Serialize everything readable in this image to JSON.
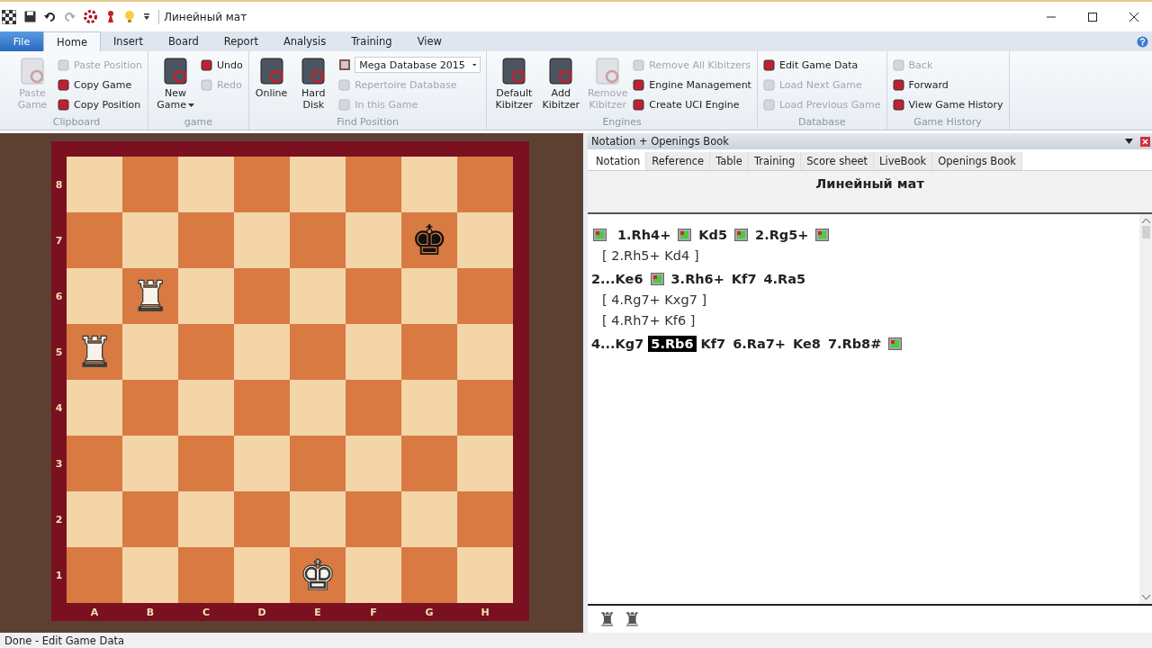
{
  "window": {
    "title": "Линейный мат"
  },
  "ribbon_tabs": [
    {
      "label": "File",
      "kind": "file",
      "selected": false
    },
    {
      "label": "Home",
      "kind": "tab",
      "selected": true
    },
    {
      "label": "Insert",
      "kind": "tab",
      "selected": false
    },
    {
      "label": "Board",
      "kind": "tab",
      "selected": false
    },
    {
      "label": "Report",
      "kind": "tab",
      "selected": false
    },
    {
      "label": "Analysis",
      "kind": "tab",
      "selected": false
    },
    {
      "label": "Training",
      "kind": "tab",
      "selected": false
    },
    {
      "label": "View",
      "kind": "tab",
      "selected": false
    }
  ],
  "ribbon_groups": [
    {
      "label": "Clipboard",
      "items": [
        {
          "kind": "large",
          "label": "Paste Game",
          "disabled": true,
          "menu": false
        },
        {
          "kind": "column",
          "entries": [
            {
              "kind": "small",
              "label": "Paste Position",
              "disabled": true
            },
            {
              "kind": "small",
              "label": "Copy Game",
              "disabled": false
            },
            {
              "kind": "small",
              "label": "Copy Position",
              "disabled": false
            }
          ]
        }
      ]
    },
    {
      "label": "game",
      "items": [
        {
          "kind": "large",
          "label": "New Game",
          "disabled": false,
          "menu": true
        },
        {
          "kind": "column",
          "entries": [
            {
              "kind": "small",
              "label": "Undo",
              "disabled": false
            },
            {
              "kind": "small",
              "label": "Redo",
              "disabled": true
            }
          ]
        }
      ]
    },
    {
      "label": "Find Position",
      "items": [
        {
          "kind": "large",
          "label": "Online",
          "disabled": false,
          "menu": false
        },
        {
          "kind": "large",
          "label": "Hard Disk",
          "disabled": false,
          "menu": false
        },
        {
          "kind": "column",
          "entries": [
            {
              "kind": "combo",
              "label": "Mega Database 2015",
              "disabled": false
            },
            {
              "kind": "small",
              "label": "Repertoire Database",
              "disabled": true
            },
            {
              "kind": "small",
              "label": "In this Game",
              "disabled": true
            }
          ]
        }
      ]
    },
    {
      "label": "Engines",
      "items": [
        {
          "kind": "large",
          "label": "Default Kibitzer",
          "disabled": false,
          "menu": false
        },
        {
          "kind": "large",
          "label": "Add Kibitzer",
          "disabled": false,
          "menu": false
        },
        {
          "kind": "large",
          "label": "Remove Kibitzer",
          "disabled": true,
          "menu": false
        },
        {
          "kind": "column",
          "entries": [
            {
              "kind": "small",
              "label": "Remove All Kibitzers",
              "disabled": true
            },
            {
              "kind": "small",
              "label": "Engine Management",
              "disabled": false
            },
            {
              "kind": "small",
              "label": "Create UCI Engine",
              "disabled": false
            }
          ]
        }
      ]
    },
    {
      "label": "Database",
      "items": [
        {
          "kind": "column",
          "entries": [
            {
              "kind": "small",
              "label": "Edit Game Data",
              "disabled": false
            },
            {
              "kind": "small",
              "label": "Load Next Game",
              "disabled": true
            },
            {
              "kind": "small",
              "label": "Load Previous Game",
              "disabled": true
            }
          ]
        }
      ]
    },
    {
      "label": "Game History",
      "items": [
        {
          "kind": "column",
          "entries": [
            {
              "kind": "small",
              "label": "Back",
              "disabled": true
            },
            {
              "kind": "small",
              "label": "Forward",
              "disabled": false
            },
            {
              "kind": "small",
              "label": "View Game History",
              "disabled": false
            }
          ]
        }
      ]
    }
  ],
  "board": {
    "files": [
      "A",
      "B",
      "C",
      "D",
      "E",
      "F",
      "G",
      "H"
    ],
    "rows": [
      {
        "rank": "8",
        "cells": [
          {
            "light": true
          },
          {
            "light": false
          },
          {
            "light": true
          },
          {
            "light": false
          },
          {
            "light": true
          },
          {
            "light": false
          },
          {
            "light": true
          },
          {
            "light": false
          }
        ]
      },
      {
        "rank": "7",
        "cells": [
          {
            "light": false
          },
          {
            "light": true
          },
          {
            "light": false
          },
          {
            "light": true
          },
          {
            "light": false
          },
          {
            "light": true
          },
          {
            "light": false,
            "piece": "♚",
            "black": true
          },
          {
            "light": true
          }
        ]
      },
      {
        "rank": "6",
        "cells": [
          {
            "light": true
          },
          {
            "light": false,
            "piece": "♜",
            "black": false
          },
          {
            "light": true
          },
          {
            "light": false
          },
          {
            "light": true
          },
          {
            "light": false
          },
          {
            "light": true
          },
          {
            "light": false
          }
        ]
      },
      {
        "rank": "5",
        "cells": [
          {
            "light": false,
            "piece": "♜",
            "black": false
          },
          {
            "light": true
          },
          {
            "light": false
          },
          {
            "light": true
          },
          {
            "light": false
          },
          {
            "light": true
          },
          {
            "light": false
          },
          {
            "light": true
          }
        ]
      },
      {
        "rank": "4",
        "cells": [
          {
            "light": true
          },
          {
            "light": false
          },
          {
            "light": true
          },
          {
            "light": false
          },
          {
            "light": true
          },
          {
            "light": false
          },
          {
            "light": true
          },
          {
            "light": false
          }
        ]
      },
      {
        "rank": "3",
        "cells": [
          {
            "light": false
          },
          {
            "light": true
          },
          {
            "light": false
          },
          {
            "light": true
          },
          {
            "light": false
          },
          {
            "light": true
          },
          {
            "light": false
          },
          {
            "light": true
          }
        ]
      },
      {
        "rank": "2",
        "cells": [
          {
            "light": true
          },
          {
            "light": false
          },
          {
            "light": true
          },
          {
            "light": false
          },
          {
            "light": true
          },
          {
            "light": false
          },
          {
            "light": true
          },
          {
            "light": false
          }
        ]
      },
      {
        "rank": "1",
        "cells": [
          {
            "light": false
          },
          {
            "light": true
          },
          {
            "light": false
          },
          {
            "light": true
          },
          {
            "light": false,
            "piece": "♚",
            "black": false
          },
          {
            "light": true
          },
          {
            "light": false
          },
          {
            "light": true
          }
        ]
      }
    ]
  },
  "notation_panel": {
    "title": "Notation + Openings Book",
    "tabs": [
      {
        "label": "Notation",
        "selected": true
      },
      {
        "label": "Reference",
        "selected": false
      },
      {
        "label": "Table",
        "selected": false
      },
      {
        "label": "Training",
        "selected": false
      },
      {
        "label": "Score sheet",
        "selected": false
      },
      {
        "label": "LiveBook",
        "selected": false
      },
      {
        "label": "Openings Book",
        "selected": false
      }
    ],
    "game_title": "Линейный мат",
    "lines": [
      {
        "kind": "main",
        "tokens": [
          {
            "kind": "diagram"
          },
          {
            "kind": "move",
            "text": "1.Rh4+",
            "selected": false
          },
          {
            "kind": "diagram"
          },
          {
            "kind": "move",
            "text": "Kd5",
            "selected": false
          },
          {
            "kind": "diagram"
          },
          {
            "kind": "move",
            "text": "2.Rg5+",
            "selected": false
          },
          {
            "kind": "diagram"
          }
        ]
      },
      {
        "kind": "variation",
        "text": "[ 2.Rh5+  Kd4 ]"
      },
      {
        "kind": "main",
        "tokens": [
          {
            "kind": "move",
            "text": "2...Ke6",
            "selected": false
          },
          {
            "kind": "diagram"
          },
          {
            "kind": "move",
            "text": "3.Rh6+",
            "selected": false
          },
          {
            "kind": "move",
            "text": "Kf7",
            "selected": false
          },
          {
            "kind": "move",
            "text": "4.Ra5",
            "selected": false
          }
        ]
      },
      {
        "kind": "variation",
        "text": "[ 4.Rg7+  Kxg7 ]"
      },
      {
        "kind": "variation",
        "text": "[ 4.Rh7+  Kf6 ]"
      },
      {
        "kind": "main",
        "tokens": [
          {
            "kind": "move",
            "text": "4...Kg7",
            "selected": false
          },
          {
            "kind": "move",
            "text": "5.Rb6",
            "selected": true
          },
          {
            "kind": "move",
            "text": "Kf7",
            "selected": false
          },
          {
            "kind": "move",
            "text": "6.Ra7+",
            "selected": false
          },
          {
            "kind": "move",
            "text": "Ke8",
            "selected": false
          },
          {
            "kind": "move",
            "text": "7.Rb8#",
            "selected": false
          },
          {
            "kind": "diagram"
          }
        ]
      }
    ],
    "material": [
      "♜",
      "♜"
    ]
  },
  "status_bar": "Done - Edit Game Data"
}
